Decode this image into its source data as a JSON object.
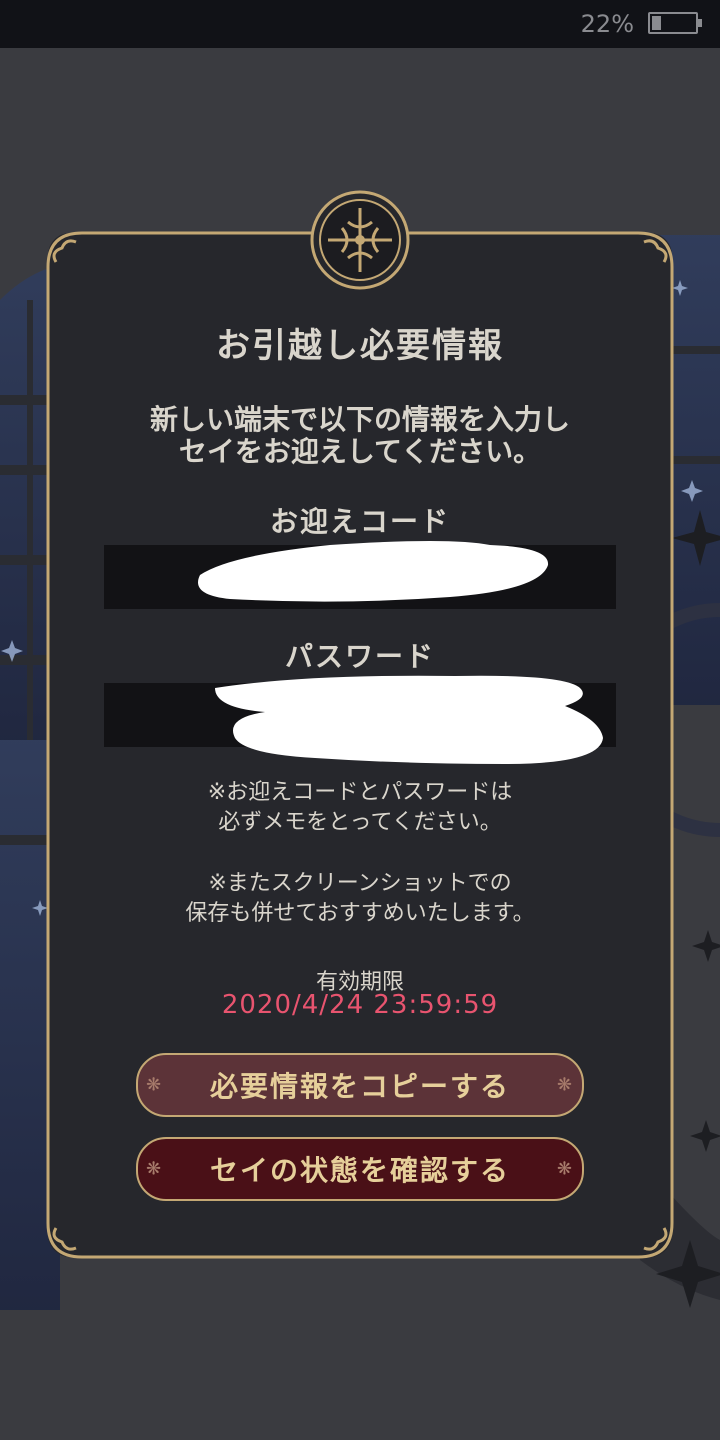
{
  "status_bar": {
    "battery_percent": "22%",
    "battery_level": 0.22
  },
  "dialog": {
    "title": "お引越し必要情報",
    "message_line1": "新しい端末で以下の情報を入力し",
    "message_line2": "セイをお迎えしてください。",
    "code_label": "お迎えコード",
    "code_value": "",
    "password_label": "パスワード",
    "password_value": "",
    "note1_line1": "※お迎えコードとパスワードは",
    "note1_line2": "必ずメモをとってください。",
    "note2_line1": "※またスクリーンショットでの",
    "note2_line2": "保存も併せておすすめいたします。",
    "expiry_label": "有効期限",
    "expiry_value": "2020/4/24 23:59:59",
    "copy_button_label": "必要情報をコピーする",
    "check_button_label": "セイの状態を確認する"
  },
  "colors": {
    "accent_gold": "#c4a874",
    "expiry_red": "#e8546f",
    "button_copy_bg": "#5c3338",
    "button_check_bg": "#4a1017"
  }
}
